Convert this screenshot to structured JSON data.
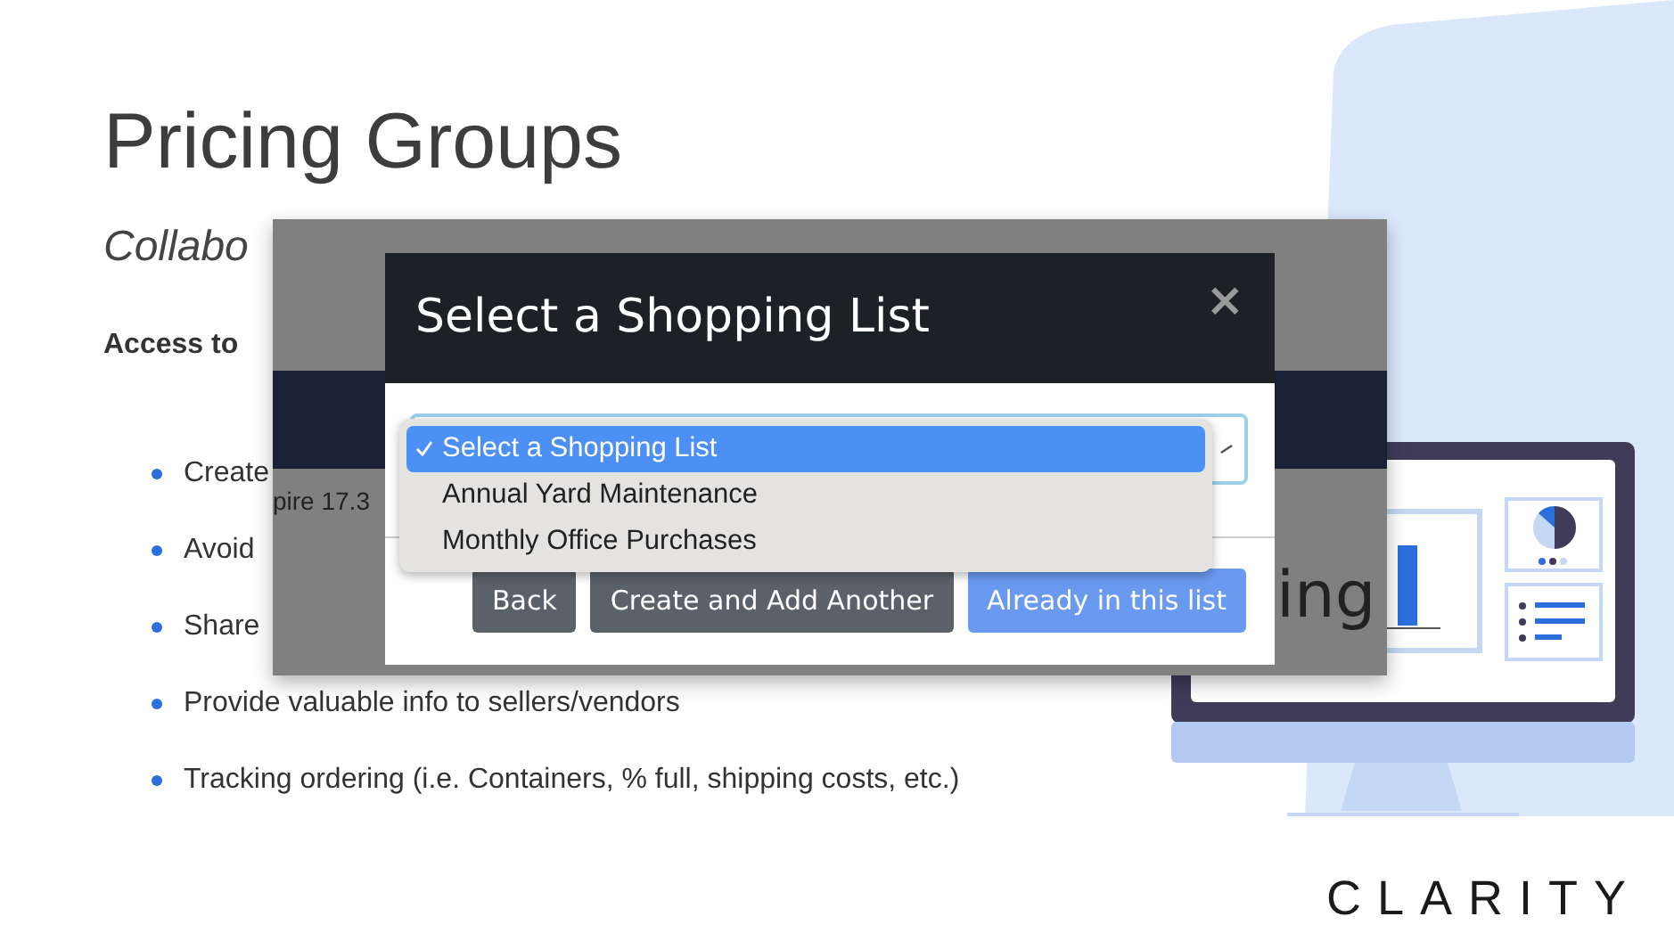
{
  "slide": {
    "title": "Pricing Groups",
    "subtitle": "Collabo",
    "section_heading": "Access to",
    "bullets": [
      "Create",
      "Avoid",
      "Share",
      "Provide valuable info to sellers/vendors",
      "Tracking ordering (i.e. Containers, % full, shipping costs, etc.)"
    ]
  },
  "screenshot": {
    "left_fragment": "pire 17.3",
    "right_fragment": "ing",
    "dialog": {
      "title": "Select a Shopping List",
      "close": "×",
      "options": [
        {
          "label": "Select a Shopping List",
          "selected": true
        },
        {
          "label": "Annual Yard Maintenance",
          "selected": false
        },
        {
          "label": "Monthly Office Purchases",
          "selected": false
        }
      ],
      "buttons": [
        {
          "label": "Back",
          "kind": "secondary"
        },
        {
          "label": "Create and Add Another",
          "kind": "secondary"
        },
        {
          "label": "Already in this list",
          "kind": "primary"
        }
      ]
    }
  },
  "logo": "CLARITY"
}
